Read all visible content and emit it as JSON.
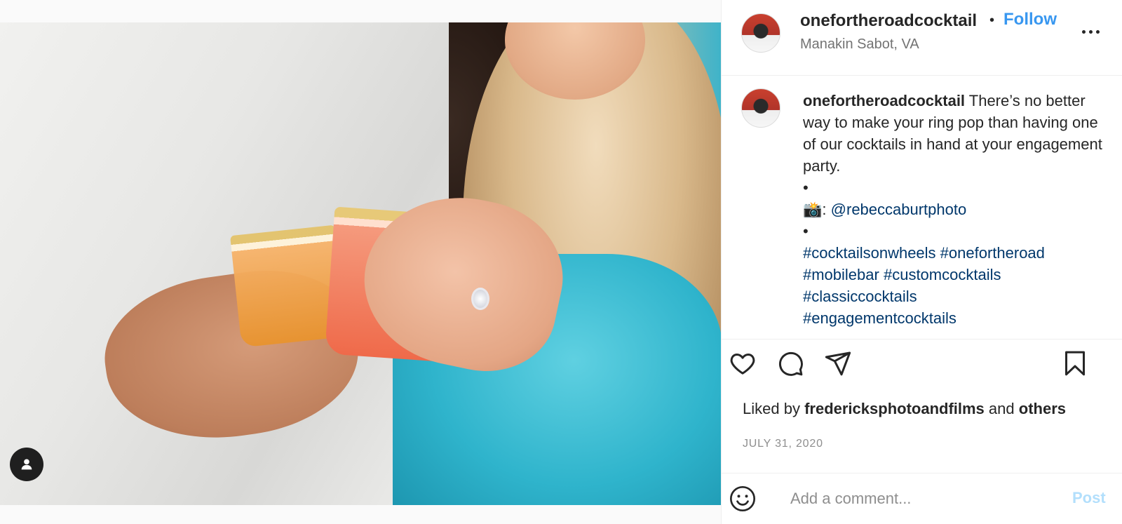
{
  "post": {
    "username": "onefortheroadcocktail",
    "separator": "•",
    "follow_label": "Follow",
    "location": "Manakin Sabot, VA"
  },
  "caption": {
    "username": "onefortheroadcocktail",
    "text": "There’s no better way to make your ring pop than having one of our cocktails in hand at your engagement party.",
    "bullet1": "•",
    "camera_emoji": "📸",
    "credit_sep": ":",
    "photo_credit": "@rebeccaburtphoto",
    "bullet2": "•",
    "hashtags": [
      "#cocktailsonwheels",
      "#onefortheroad",
      "#mobilebar",
      "#customcocktails",
      "#classiccocktails",
      "#engagementcocktails"
    ]
  },
  "actions": {
    "icons": [
      "heart-icon",
      "comment-icon",
      "share-icon",
      "bookmark-icon"
    ]
  },
  "likes": {
    "prefix": "Liked by",
    "user": "fredericksphotoandfilms",
    "and": "and",
    "others": "others"
  },
  "date": "JULY 31, 2020",
  "comment": {
    "placeholder": "Add a comment...",
    "post_label": "Post"
  },
  "colors": {
    "follow": "#3897f0",
    "link": "#00376b",
    "post_disabled": "#b2dffc",
    "muted": "#8e8e8e"
  }
}
